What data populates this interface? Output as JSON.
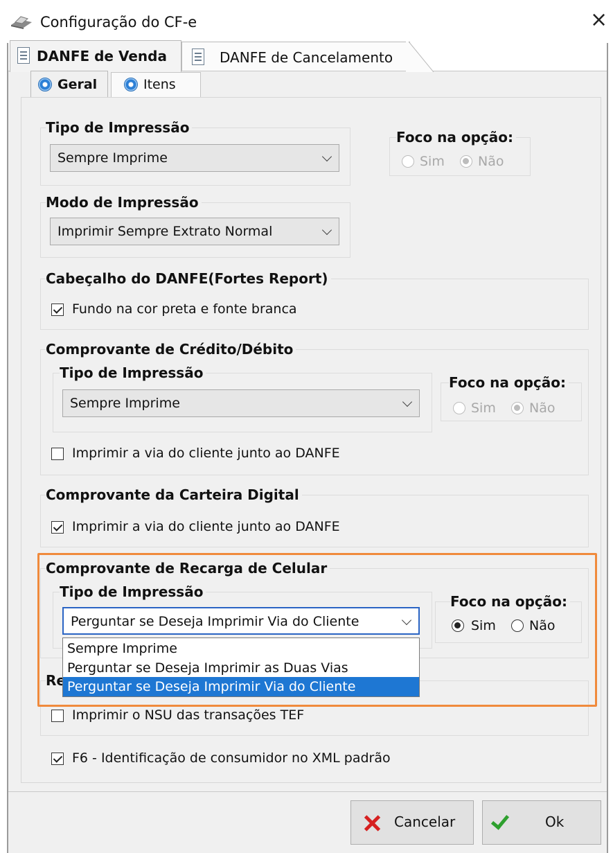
{
  "window": {
    "title": "Configuração do CF-e",
    "close_label": "×"
  },
  "tabs": {
    "main": [
      "DANFE de Venda",
      "DANFE de Cancelamento"
    ],
    "sub": [
      "Geral",
      "Itens"
    ]
  },
  "sections": {
    "tipo_impressao": {
      "title": "Tipo de Impressão",
      "value": "Sempre Imprime"
    },
    "foco_top": {
      "title": "Foco na opção:",
      "sim": "Sim",
      "nao": "Não",
      "selected": "Não",
      "enabled": false
    },
    "modo_impressao": {
      "title": "Modo de Impressão",
      "value": "Imprimir Sempre Extrato Normal"
    },
    "cabecalho": {
      "title": "Cabeçalho do DANFE(Fortes Report)",
      "checkbox_label": "Fundo na cor preta e fonte branca",
      "checked": true
    },
    "credito_debito": {
      "title": "Comprovante de Crédito/Débito",
      "tipo_title": "Tipo de Impressão",
      "value": "Sempre Imprime",
      "foco_title": "Foco na opção:",
      "sim": "Sim",
      "nao": "Não",
      "selected": "Não",
      "enabled": false,
      "checkbox_label": "Imprimir a via do cliente junto ao DANFE",
      "checked": false
    },
    "carteira": {
      "title": "Comprovante da Carteira Digital",
      "checkbox_label": "Imprimir a via do cliente junto ao DANFE",
      "checked": true
    },
    "recarga": {
      "title": "Comprovante de Recarga de Celular",
      "tipo_title": "Tipo de Impressão",
      "value": "Perguntar se Deseja Imprimir Via do Cliente",
      "foco_title": "Foco na opção:",
      "sim": "Sim",
      "nao": "Não",
      "selected": "Sim",
      "enabled": true,
      "options": [
        "Sempre Imprime",
        "Perguntar se Deseja Imprimir as Duas Vias",
        "Perguntar se Deseja Imprimir Via do Cliente"
      ],
      "selected_option_index": 2
    },
    "rede": {
      "title_partial": "Re",
      "checkbox_label": "Imprimir o NSU das transações TEF",
      "checked": false
    },
    "f6": {
      "checkbox_label": "F6 - Identificação de consumidor no XML padrão",
      "checked": true
    }
  },
  "buttons": {
    "cancel": "Cancelar",
    "ok": "Ok"
  },
  "colors": {
    "highlight": "#f08a3c",
    "selection": "#1e77d3",
    "cancel_icon": "#d62020",
    "ok_icon": "#2ea02e"
  }
}
